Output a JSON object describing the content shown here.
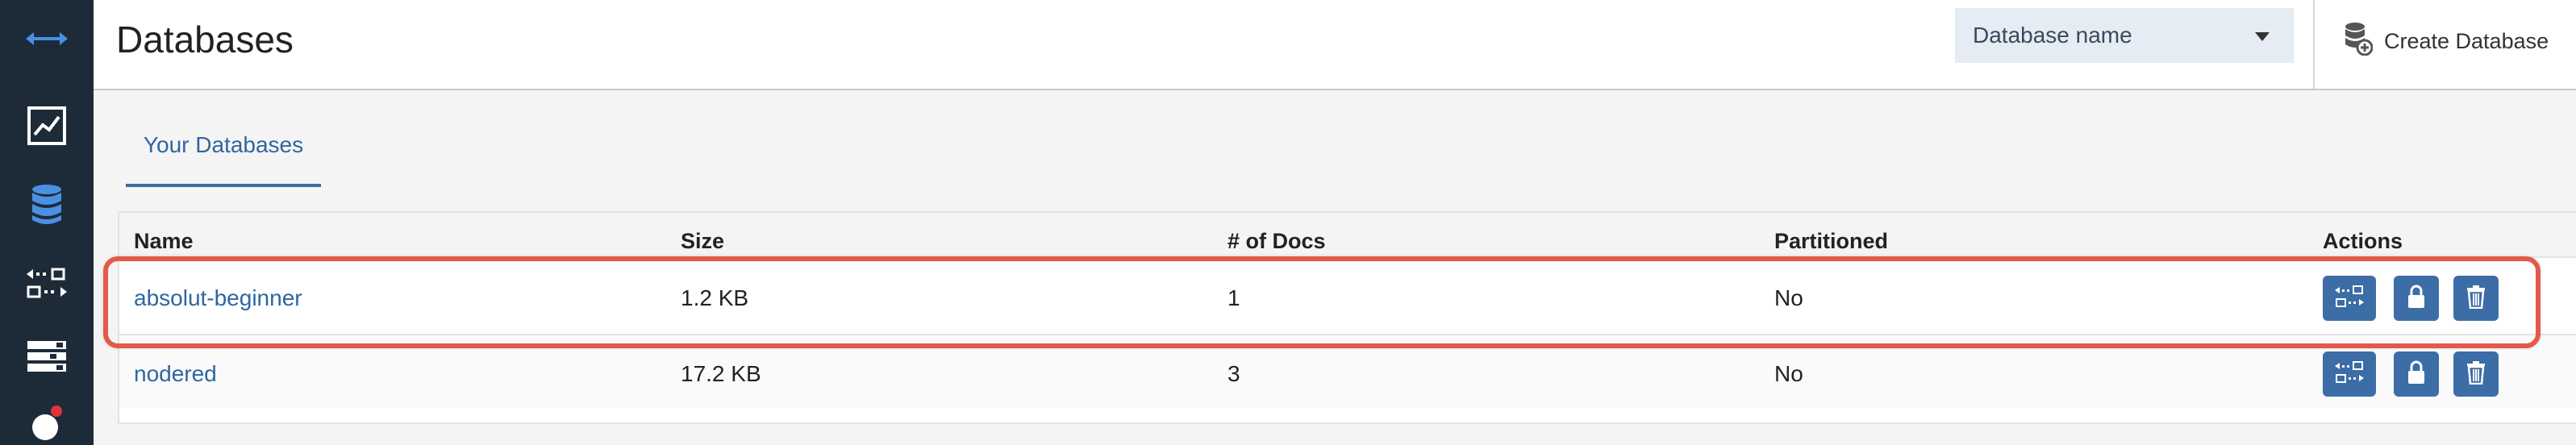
{
  "header": {
    "title": "Databases",
    "db_select": {
      "value": "Database name"
    },
    "create_label": "Create Database"
  },
  "tabs": [
    {
      "label": "Your Databases",
      "active": true
    }
  ],
  "table": {
    "columns": [
      "Name",
      "Size",
      "# of Docs",
      "Partitioned",
      "Actions"
    ],
    "rows": [
      {
        "name": "absolut-beginner",
        "size": "1.2 KB",
        "docs": "1",
        "partitioned": "No",
        "highlighted": true
      },
      {
        "name": "nodered",
        "size": "17.2 KB",
        "docs": "3",
        "partitioned": "No",
        "highlighted": false
      }
    ]
  },
  "sidebar": {
    "icons": [
      "toggle-arrows-icon",
      "activity-chart-icon",
      "database-icon",
      "replication-icon",
      "config-stack-icon",
      "notification-avatar-icon"
    ]
  },
  "colors": {
    "sidebar_bg": "#1d2b39",
    "accent": "#3c6da6",
    "link": "#2f66a1",
    "highlight_border": "#e35a4a"
  }
}
